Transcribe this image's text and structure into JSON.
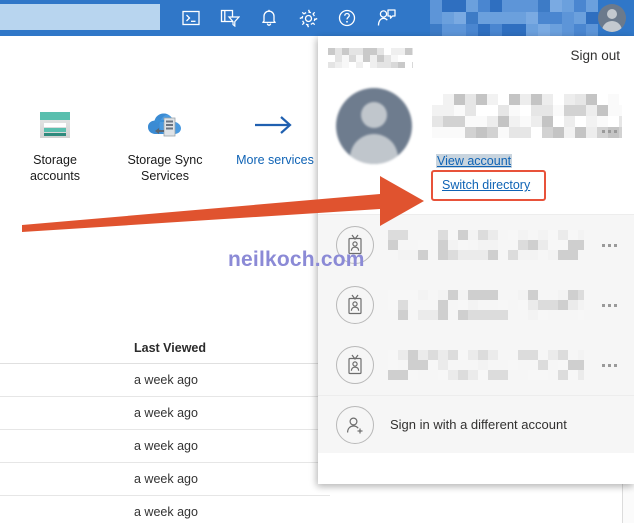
{
  "header": {
    "search_placeholder": "",
    "search_value": "",
    "icons": [
      {
        "name": "cloud-shell-icon",
        "label": "Cloud Shell"
      },
      {
        "name": "directory-filter-icon",
        "label": "Directory + subscription"
      },
      {
        "name": "notifications-bell-icon",
        "label": "Notifications"
      },
      {
        "name": "settings-gear-icon",
        "label": "Settings"
      },
      {
        "name": "help-question-icon",
        "label": "Help"
      },
      {
        "name": "feedback-person-icon",
        "label": "Feedback"
      }
    ],
    "avatar_name": "account-avatar"
  },
  "services": {
    "tiles": [
      {
        "label": "Storage\naccounts",
        "icon": "storage-accounts-icon",
        "is_link": false
      },
      {
        "label": "Storage Sync\nServices",
        "icon": "storage-sync-services-icon",
        "is_link": false
      },
      {
        "label": "More services",
        "icon": "arrow-right-icon",
        "is_link": true
      }
    ]
  },
  "table": {
    "columns": [
      "Last Viewed"
    ],
    "rows": [
      {
        "last_viewed": "a week ago"
      },
      {
        "last_viewed": "a week ago"
      },
      {
        "last_viewed": "a week ago"
      },
      {
        "last_viewed": "a week ago"
      },
      {
        "last_viewed": "a week ago"
      }
    ]
  },
  "watermark": {
    "text": "neilkoch.com",
    "color": "#8b8ad6"
  },
  "account_panel": {
    "tenant_name": "",
    "sign_out_label": "Sign out",
    "account_display_name": "",
    "view_account_label": "View account",
    "switch_directory_label": "Switch directory",
    "overflow_label": "...",
    "accounts": [
      {
        "name": "",
        "icon": "directory-badge-icon",
        "overflow": "..."
      },
      {
        "name": "",
        "icon": "directory-badge-icon",
        "overflow": "..."
      },
      {
        "name": "",
        "icon": "directory-badge-icon",
        "overflow": "..."
      }
    ],
    "sign_in_different_label": "Sign in with a different account",
    "sign_in_different_icon": "add-person-icon"
  },
  "annotation": {
    "arrow_color": "#e0532f",
    "highlight_box_color": "#e8523a",
    "points_to": "switch_directory_label"
  },
  "colors": {
    "header_blue": "#3077c8",
    "search_blue": "#b8d5ef",
    "link_blue": "#0f63b5",
    "panel_bg": "#ffffff",
    "list_bg": "#f6f6f6",
    "storage_teal": "#59bfae"
  }
}
